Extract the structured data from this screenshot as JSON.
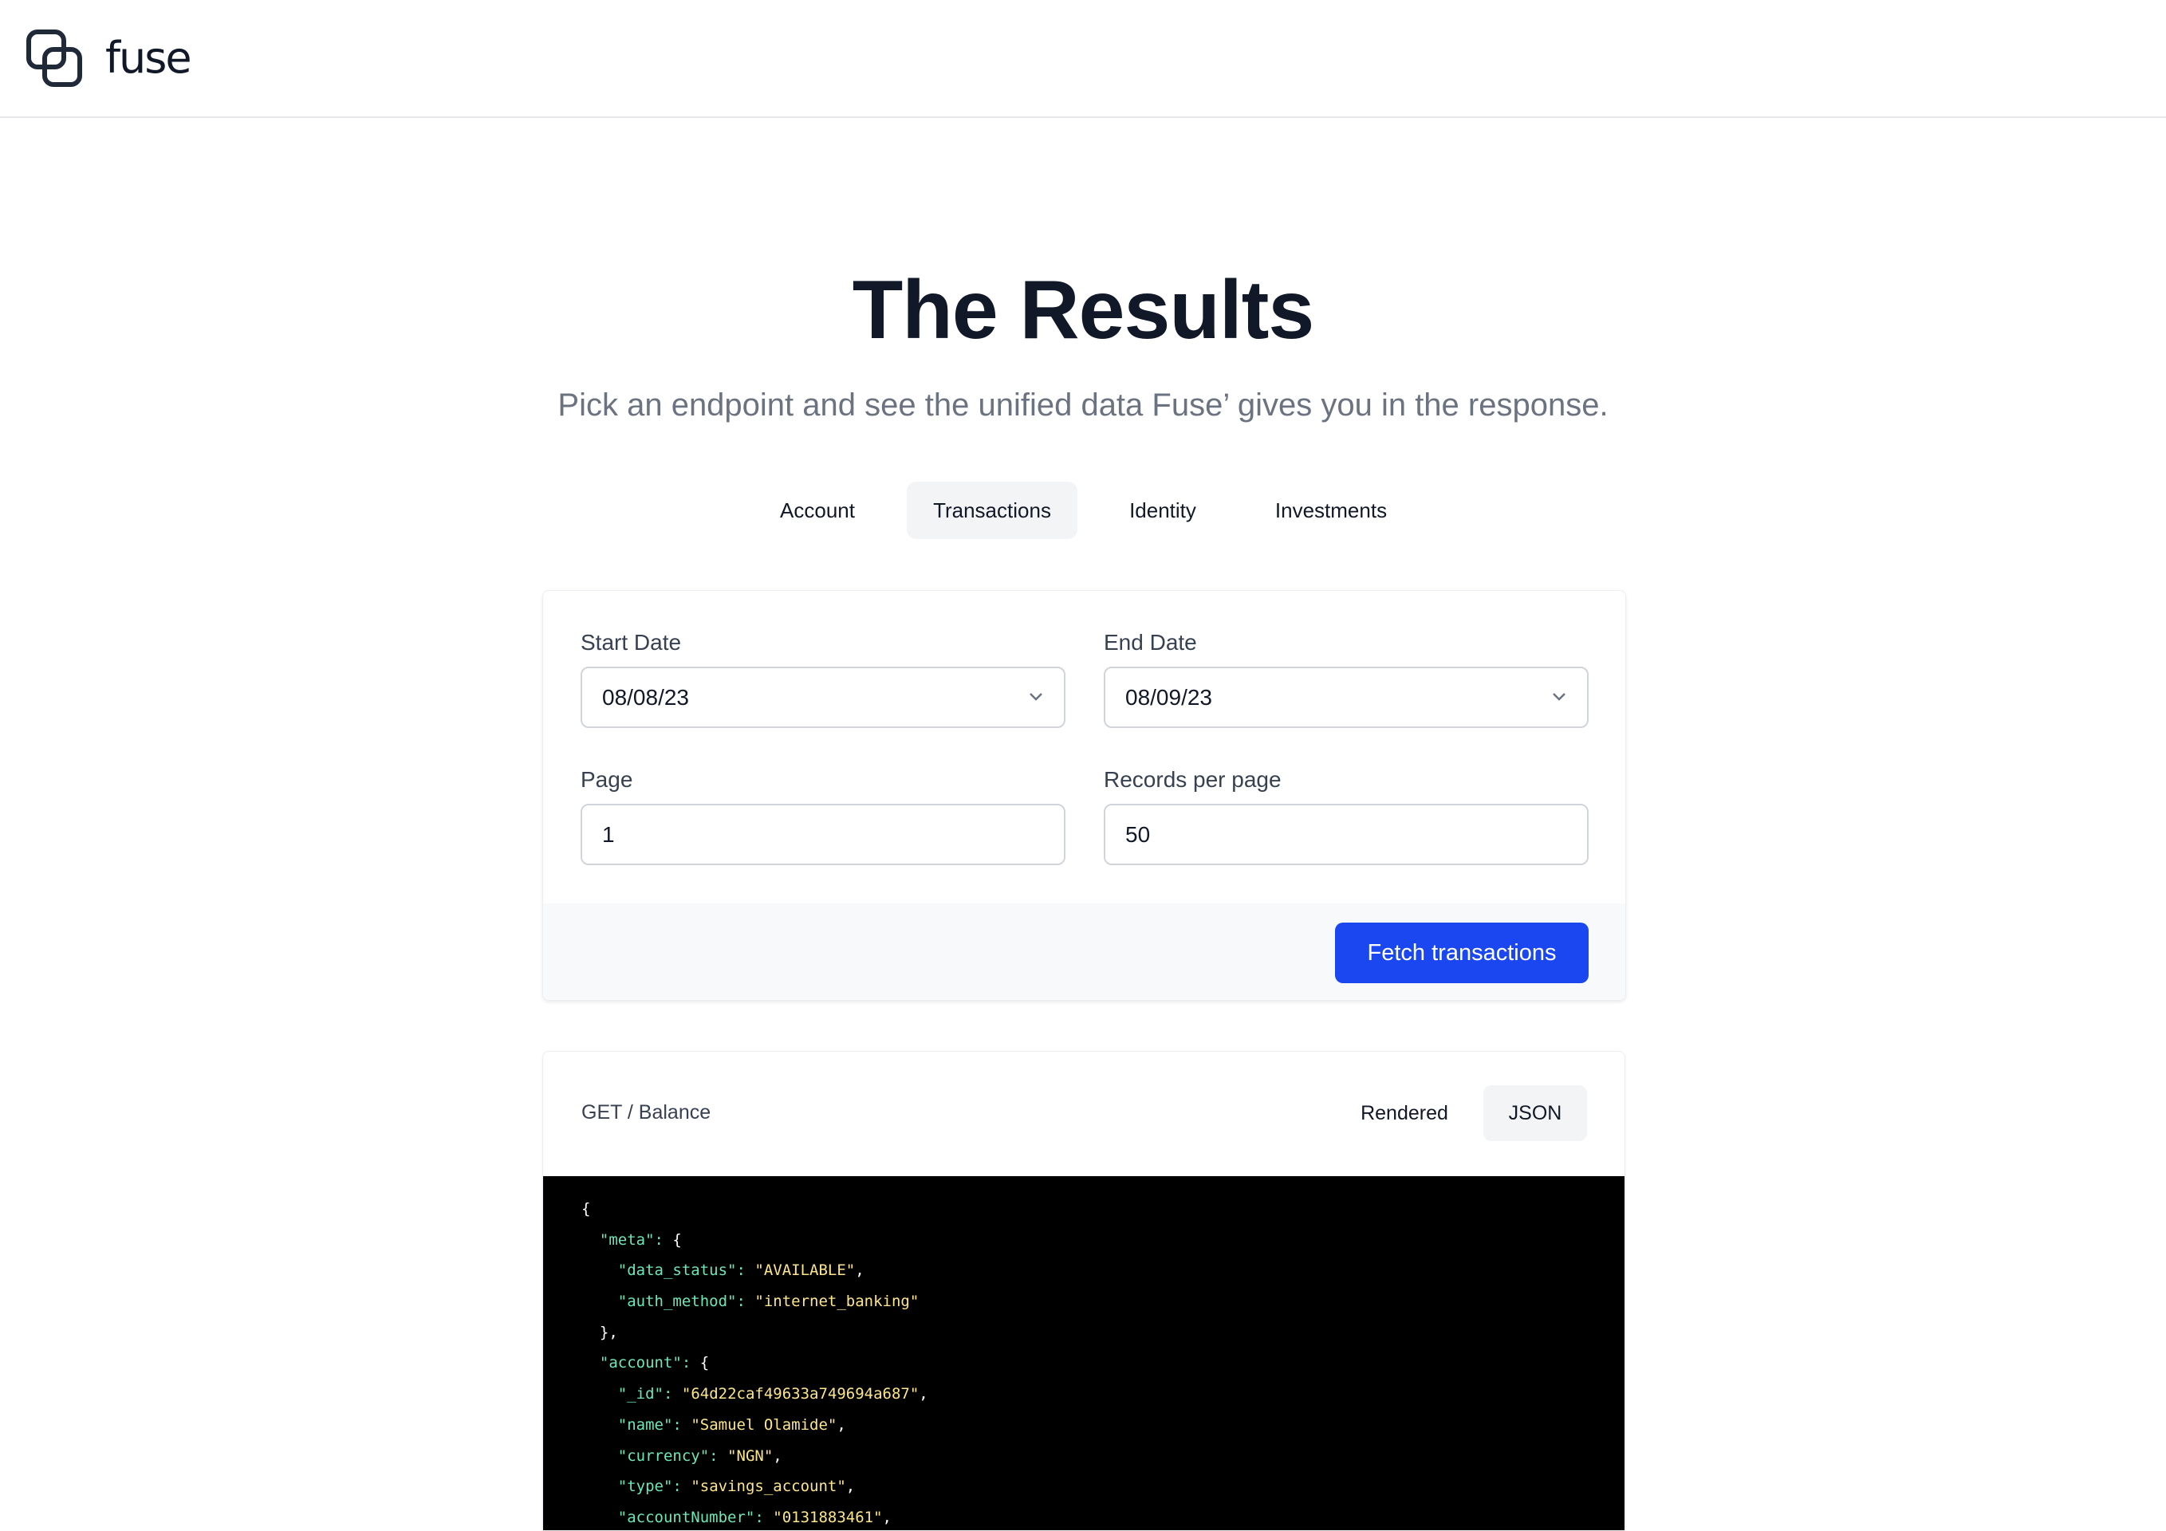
{
  "brand": {
    "name": "fuse",
    "logo_icon": "interlocked-squares-logo"
  },
  "hero": {
    "title": "The Results",
    "subtitle": "Pick an endpoint and see the unified data Fuse’ gives you in the response."
  },
  "tabs": [
    {
      "label": "Account",
      "active": false
    },
    {
      "label": "Transactions",
      "active": true
    },
    {
      "label": "Identity",
      "active": false
    },
    {
      "label": "Investments",
      "active": false
    }
  ],
  "form": {
    "start_date": {
      "label": "Start Date",
      "value": "08/08/23"
    },
    "end_date": {
      "label": "End Date",
      "value": "08/09/23"
    },
    "page": {
      "label": "Page",
      "value": "1"
    },
    "records_per_page": {
      "label": "Records per page",
      "value": "50"
    },
    "submit_label": "Fetch transactions"
  },
  "response": {
    "endpoint": "GET / Balance",
    "views": [
      {
        "label": "Rendered",
        "active": false
      },
      {
        "label": "JSON",
        "active": true
      }
    ],
    "code_lines": [
      "{",
      "  \"meta\": {",
      "    \"data_status\": \"AVAILABLE\",",
      "    \"auth_method\": \"internet_banking\"",
      "  },",
      "  \"account\": {",
      "    \"_id\": \"64d22caf49633a749694a687\",",
      "    \"name\": \"Samuel Olamide\",",
      "    \"currency\": \"NGN\",",
      "    \"type\": \"savings_account\",",
      "    \"accountNumber\": \"0131883461\","
    ]
  },
  "colors": {
    "primary_button": "#1a47f0",
    "json_key": "#6ee7b7",
    "json_string": "#fde68a",
    "code_background": "#000000"
  }
}
